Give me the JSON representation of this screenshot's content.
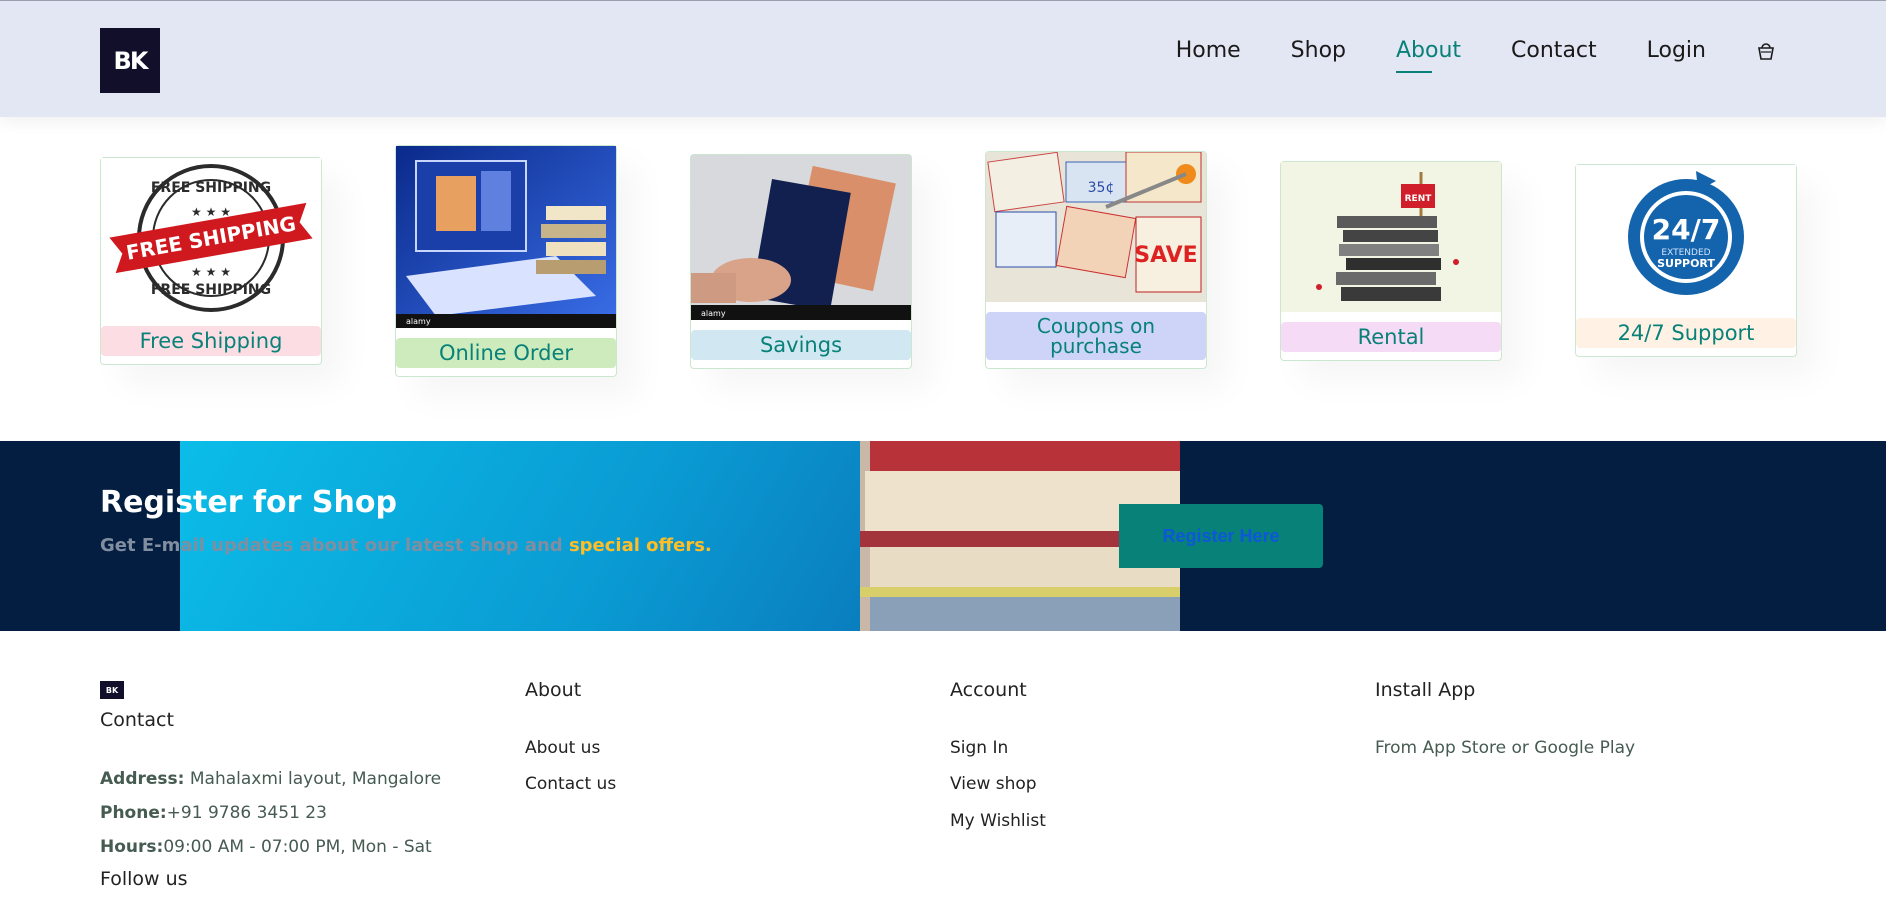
{
  "brand": {
    "logo_text": "BK"
  },
  "nav": {
    "items": [
      {
        "label": "Home",
        "active": false
      },
      {
        "label": "Shop",
        "active": false
      },
      {
        "label": "About",
        "active": true
      },
      {
        "label": "Contact",
        "active": false
      },
      {
        "label": "Login",
        "active": false
      }
    ],
    "bag_icon": "shopping-bag-icon"
  },
  "features": [
    {
      "label": "Free Shipping",
      "bg": "#fddde4",
      "image": "free-shipping-badge"
    },
    {
      "label": "Online Order",
      "bg": "#cdebbc",
      "image": "online-order-photo"
    },
    {
      "label": "Savings",
      "bg": "#d1e8f2",
      "image": "savings-photo"
    },
    {
      "label": "Coupons on purchase",
      "bg": "#cdd4f8",
      "image": "coupons-photo"
    },
    {
      "label": "Rental",
      "bg": "#f6dbf6",
      "image": "book-rental-photo"
    },
    {
      "label": "24/7 Support",
      "bg": "#fff2e5",
      "image": "support-24-7-badge"
    }
  ],
  "newsletter": {
    "title": "Register for Shop",
    "subtitle": "Get E-mail updates about our latest shop and",
    "highlight": "special offers.",
    "button": "Register Here"
  },
  "footer": {
    "logo_text": "BK",
    "contact_heading": "Contact",
    "address_label": "Address:",
    "address_value": " Mahalaxmi layout, Mangalore",
    "phone_label": "Phone:",
    "phone_value": "+91 9786 3451 23",
    "hours_label": "Hours:",
    "hours_value": "09:00 AM - 07:00 PM, Mon - Sat",
    "follow_heading": "Follow us",
    "about_heading": "About",
    "about_links": [
      "About us",
      "Contact us"
    ],
    "account_heading": "Account",
    "account_links": [
      "Sign In",
      "View shop",
      "My Wishlist"
    ],
    "install_heading": "Install App",
    "install_text": "From App Store or Google Play"
  },
  "colors": {
    "accent": "#088178",
    "header_bg": "#e3e6f3",
    "newsletter_bg": "#041e42",
    "highlight": "#ffbd27"
  }
}
